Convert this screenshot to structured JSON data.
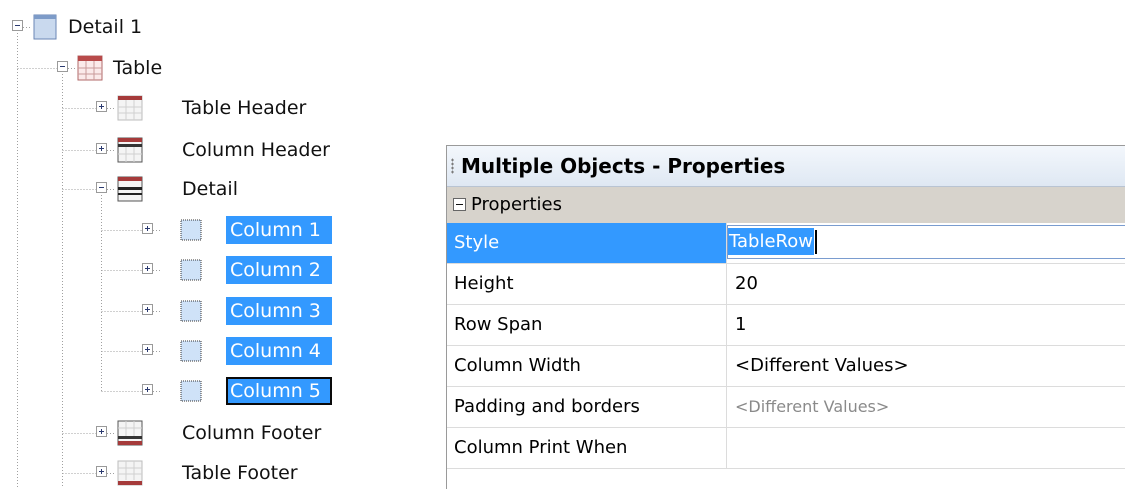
{
  "tree": {
    "nodes": [
      {
        "label": "Detail 1",
        "expander": "minus",
        "icon": "band-icon"
      },
      {
        "label": "Table",
        "expander": "minus",
        "icon": "table-icon"
      },
      {
        "label": "Table Header",
        "expander": "plus",
        "icon": "table-header-icon"
      },
      {
        "label": "Column Header",
        "expander": "plus",
        "icon": "column-header-icon"
      },
      {
        "label": "Detail",
        "expander": "minus",
        "icon": "detail-section-icon"
      },
      {
        "label": "Column 1",
        "expander": "plus",
        "icon": "column-cell-icon",
        "selected": true
      },
      {
        "label": "Column 2",
        "expander": "plus",
        "icon": "column-cell-icon",
        "selected": true
      },
      {
        "label": "Column 3",
        "expander": "plus",
        "icon": "column-cell-icon",
        "selected": true
      },
      {
        "label": "Column 4",
        "expander": "plus",
        "icon": "column-cell-icon",
        "selected": true
      },
      {
        "label": "Column 5",
        "expander": "plus",
        "icon": "column-cell-icon",
        "selected": true,
        "focused": true
      },
      {
        "label": "Column Footer",
        "expander": "plus",
        "icon": "column-footer-icon"
      },
      {
        "label": "Table Footer",
        "expander": "plus",
        "icon": "table-footer-icon"
      }
    ]
  },
  "properties": {
    "title": "Multiple Objects - Properties",
    "category": "Properties",
    "rows": [
      {
        "name": "Style",
        "value": "TableRow",
        "selected": true,
        "editing": true
      },
      {
        "name": "Height",
        "value": "20"
      },
      {
        "name": "Row Span",
        "value": "1"
      },
      {
        "name": "Column Width",
        "value": "<Different Values>"
      },
      {
        "name": "Padding and borders",
        "value": "<Different Values>",
        "greyed": true
      },
      {
        "name": "Column Print When",
        "value": ""
      }
    ]
  },
  "colors": {
    "selection": "#3399ff",
    "header_gradient_start": "#f3f7fc",
    "header_gradient_end": "#dfe8f3",
    "category_bg": "#d7d3cc"
  }
}
